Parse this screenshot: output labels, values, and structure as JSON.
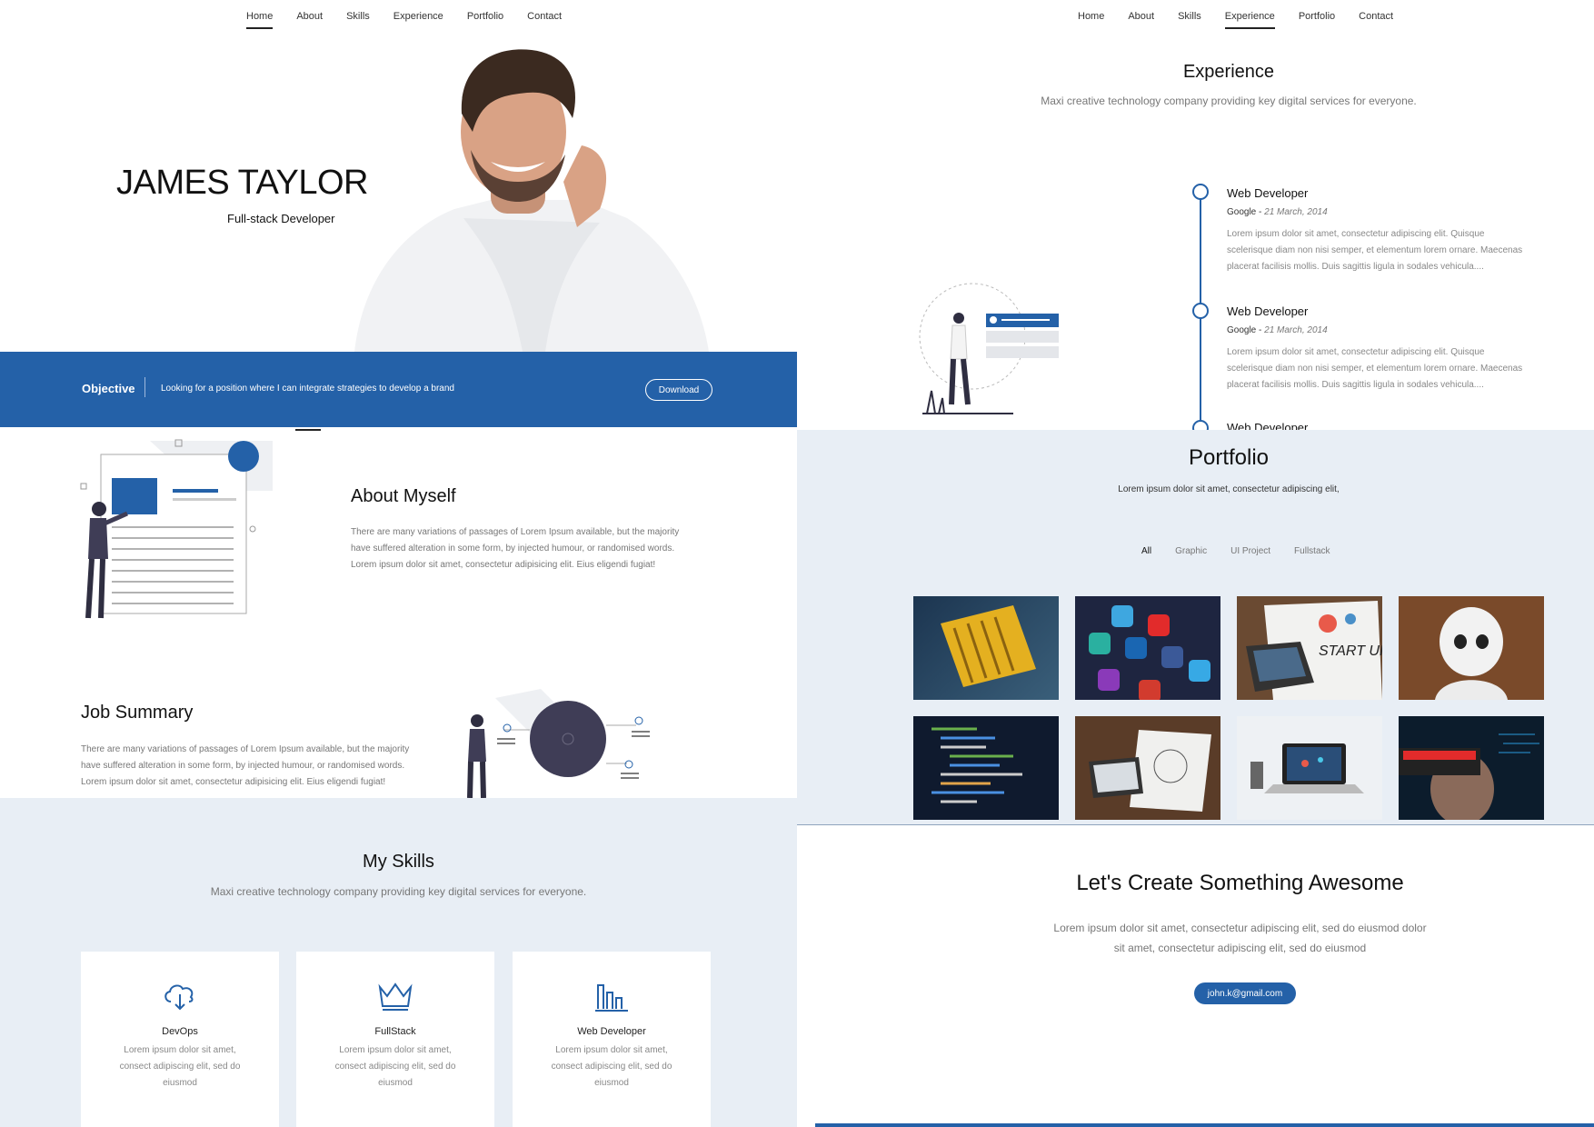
{
  "nav_left": {
    "items": [
      "Home",
      "About",
      "Skills",
      "Experience",
      "Portfolio",
      "Contact"
    ],
    "active": "Home"
  },
  "nav_right": {
    "items": [
      "Home",
      "About",
      "Skills",
      "Experience",
      "Portfolio",
      "Contact"
    ],
    "active": "Experience"
  },
  "hero": {
    "name": "JAMES TAYLOR",
    "role": "Full-stack Developer"
  },
  "objective": {
    "label": "Objective",
    "text": "Looking for a position where I can integrate strategies to develop a brand",
    "button": "Download"
  },
  "about": {
    "title": "About Myself",
    "lines": [
      "There are many variations of passages of Lorem Ipsum available, but the majority",
      "have suffered alteration in some form, by injected humour, or randomised words.",
      "Lorem ipsum dolor sit amet, consectetur adipisicing elit. Eius eligendi fugiat!"
    ]
  },
  "job_summary": {
    "title": "Job Summary",
    "lines": [
      "There are many variations of passages of Lorem Ipsum available, but the majority",
      "have suffered alteration in some form, by injected humour, or randomised words.",
      "Lorem ipsum dolor sit amet, consectetur adipisicing elit. Eius eligendi fugiat!"
    ]
  },
  "skills": {
    "title": "My Skills",
    "subtitle": "Maxi creative technology company providing key digital services for everyone.",
    "cards": [
      {
        "icon": "cloud-download-icon",
        "title": "DevOps",
        "lines": [
          "Lorem ipsum dolor sit amet,",
          "consect adipiscing elit, sed do",
          "eiusmod"
        ]
      },
      {
        "icon": "crown-icon",
        "title": "FullStack",
        "lines": [
          "Lorem ipsum dolor sit amet,",
          "consect adipiscing elit, sed do",
          "eiusmod"
        ]
      },
      {
        "icon": "bar-chart-icon",
        "title": "Web Developer",
        "lines": [
          "Lorem ipsum dolor sit amet,",
          "consect adipiscing elit, sed do",
          "eiusmod"
        ]
      }
    ]
  },
  "experience": {
    "title": "Experience",
    "subtitle": "Maxi creative technology company providing key digital services for everyone.",
    "jobs": [
      {
        "title": "Web Developer",
        "company": "Google",
        "date": "21 March, 2014",
        "lines": [
          "Lorem ipsum dolor sit amet, consectetur adipiscing elit. Quisque",
          "scelerisque diam non nisi semper, et elementum lorem ornare. Maecenas",
          "placerat facilisis mollis. Duis sagittis ligula in sodales vehicula...."
        ]
      },
      {
        "title": "Web Developer",
        "company": "Google",
        "date": "21 March, 2014",
        "lines": [
          "Lorem ipsum dolor sit amet, consectetur adipiscing elit. Quisque",
          "scelerisque diam non nisi semper, et elementum lorem ornare. Maecenas",
          "placerat facilisis mollis. Duis sagittis ligula in sodales vehicula...."
        ]
      },
      {
        "title": "Web Developer"
      }
    ]
  },
  "portfolio": {
    "title": "Portfolio",
    "subtitle": "Lorem ipsum dolor sit amet, consectetur adipiscing elit,",
    "filters": [
      "All",
      "Graphic",
      "UI Project",
      "Fullstack"
    ],
    "active_filter": "All",
    "thumbs": [
      "Graphics card",
      "Social apps",
      "START UP",
      "Robot",
      "Code editor",
      "Sketch desk",
      "Laptop desk",
      "VR headset"
    ]
  },
  "contact": {
    "title": "Let's Create Something Awesome",
    "lines": [
      "Lorem ipsum dolor sit amet, consectetur adipiscing elit, sed do eiusmod dolor",
      "sit amet, consectetur adipiscing elit, sed do eiusmod"
    ],
    "email": "john.k@gmail.com"
  },
  "colors": {
    "primary": "#2461a8",
    "light_bg": "#e8eef5"
  }
}
